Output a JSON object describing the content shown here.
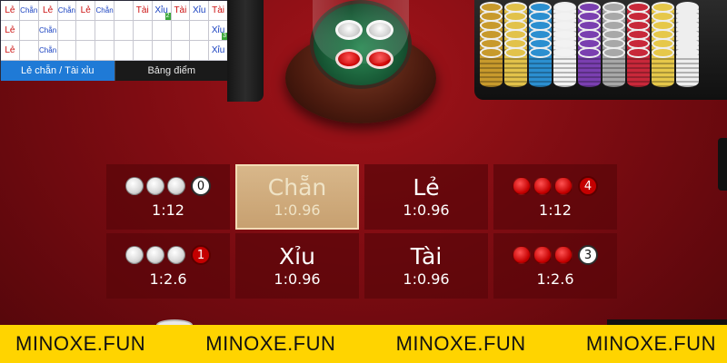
{
  "scoreboard": {
    "rows": [
      [
        {
          "text": "Lẻ",
          "kind": "le"
        },
        {
          "text": "Chẵn",
          "kind": "chan"
        },
        {
          "text": "Lẻ",
          "kind": "le"
        },
        {
          "text": "Chẵn",
          "kind": "chan"
        },
        {
          "text": "Lẻ",
          "kind": "le"
        },
        {
          "text": "Chẵn",
          "kind": "chan"
        },
        {
          "text": "",
          "kind": ""
        },
        {
          "text": "Tài",
          "kind": "tai"
        },
        {
          "text": "Xỉu",
          "kind": "xiu",
          "badge": "2"
        },
        {
          "text": "Tài",
          "kind": "tai"
        },
        {
          "text": "Xỉu",
          "kind": "xiu"
        },
        {
          "text": "Tài",
          "kind": "tai"
        }
      ],
      [
        {
          "text": "Lẻ",
          "kind": "le"
        },
        {
          "text": "",
          "kind": ""
        },
        {
          "text": "Chẵn",
          "kind": "chan"
        },
        {
          "text": "",
          "kind": ""
        },
        {
          "text": "",
          "kind": ""
        },
        {
          "text": "",
          "kind": ""
        },
        {
          "text": "",
          "kind": ""
        },
        {
          "text": "",
          "kind": ""
        },
        {
          "text": "",
          "kind": ""
        },
        {
          "text": "",
          "kind": ""
        },
        {
          "text": "",
          "kind": ""
        },
        {
          "text": "Xỉu",
          "kind": "xiu",
          "badge": "3"
        }
      ],
      [
        {
          "text": "Lẻ",
          "kind": "le"
        },
        {
          "text": "",
          "kind": ""
        },
        {
          "text": "Chẵn",
          "kind": "chan"
        },
        {
          "text": "",
          "kind": ""
        },
        {
          "text": "",
          "kind": ""
        },
        {
          "text": "",
          "kind": ""
        },
        {
          "text": "",
          "kind": ""
        },
        {
          "text": "",
          "kind": ""
        },
        {
          "text": "",
          "kind": ""
        },
        {
          "text": "",
          "kind": ""
        },
        {
          "text": "",
          "kind": ""
        },
        {
          "text": "Xỉu",
          "kind": "xiu"
        }
      ]
    ],
    "tabs": [
      {
        "label": "Lẻ chẵn / Tài xỉu",
        "active": true
      },
      {
        "label": "Bảng điểm",
        "active": false
      }
    ]
  },
  "chip_colors": [
    "#c89a2c",
    "#e2c24a",
    "#2b8fd0",
    "#f2f2f2",
    "#7a3fb0",
    "#a8a8a8",
    "#c8283a",
    "#e6c84a",
    "#eeeeee"
  ],
  "bets": [
    {
      "name": "bet-four-white",
      "title": "",
      "odds": "1:12",
      "dots": [
        "w",
        "w",
        "w"
      ],
      "count": "0",
      "count_style": "white",
      "highlight": false
    },
    {
      "name": "bet-chan",
      "title": "Chẵn",
      "odds": "1:0.96",
      "dots": [],
      "count": "",
      "count_style": "",
      "highlight": true
    },
    {
      "name": "bet-le",
      "title": "Lẻ",
      "odds": "1:0.96",
      "dots": [],
      "count": "",
      "count_style": "",
      "highlight": false
    },
    {
      "name": "bet-four-red",
      "title": "",
      "odds": "1:12",
      "dots": [
        "r",
        "r",
        "r"
      ],
      "count": "4",
      "count_style": "red",
      "highlight": false
    },
    {
      "name": "bet-three-white",
      "title": "",
      "odds": "1:2.6",
      "dots": [
        "w",
        "w",
        "w"
      ],
      "count": "1",
      "count_style": "red",
      "highlight": false
    },
    {
      "name": "bet-xiu",
      "title": "Xỉu",
      "odds": "1:0.96",
      "dots": [],
      "count": "",
      "count_style": "",
      "highlight": false
    },
    {
      "name": "bet-tai",
      "title": "Tài",
      "odds": "1:0.96",
      "dots": [],
      "count": "",
      "count_style": "",
      "highlight": false
    },
    {
      "name": "bet-three-red",
      "title": "",
      "odds": "1:2.6",
      "dots": [
        "r",
        "r",
        "r"
      ],
      "count": "3",
      "count_style": "white",
      "highlight": false
    }
  ],
  "banner": {
    "items": [
      "MINOXE.FUN",
      "MINOXE.FUN",
      "MINOXE.FUN",
      "MINOXE.FUN"
    ]
  }
}
